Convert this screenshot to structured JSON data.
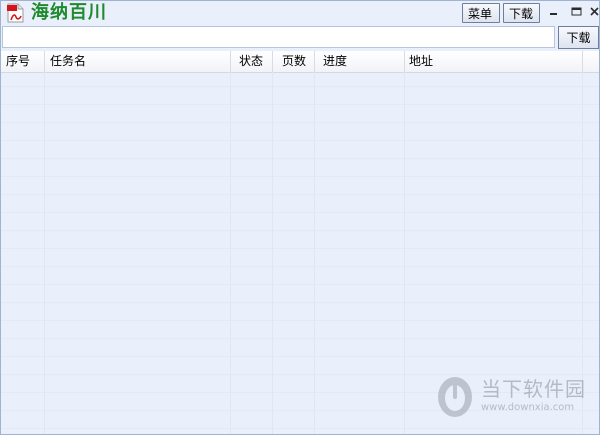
{
  "window": {
    "title": "海纳百川",
    "menu_label": "菜单",
    "download_top_label": "下载"
  },
  "url_bar": {
    "value": "",
    "placeholder": "",
    "download_label": "下载"
  },
  "table": {
    "columns": [
      "序号",
      "任务名",
      "状态",
      "页数",
      "进度",
      "地址"
    ],
    "rows": []
  },
  "watermark": {
    "name": "当下软件园",
    "url": "www.downxia.com"
  },
  "icons": {
    "app": "pdf-file-icon",
    "minimize": "minimize-icon",
    "maximize": "maximize-icon",
    "close": "close-icon",
    "watermark_logo": "downxia-logo-icon"
  }
}
